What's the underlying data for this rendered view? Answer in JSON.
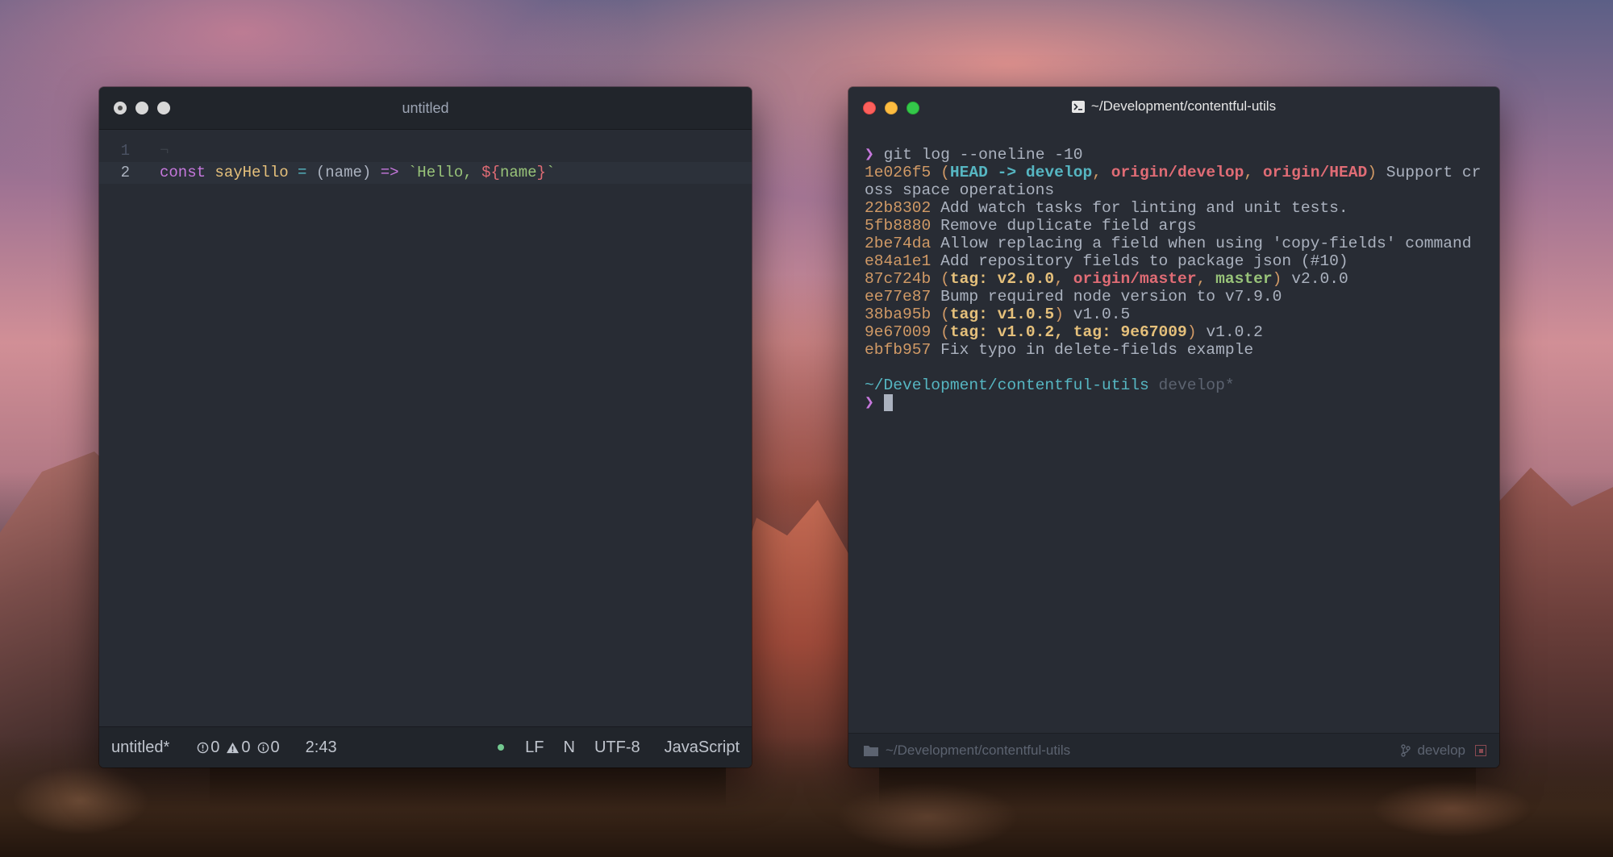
{
  "colors": {
    "text": "#abb2bf",
    "hash": "#d19a66",
    "cyan": "#56b6c2",
    "green": "#98c379",
    "red": "#e06c75",
    "yellow": "#e5c07b",
    "purple": "#c678dd",
    "muted": "#5c6370"
  },
  "editor": {
    "title": "untitled",
    "lines": [
      {
        "number": "1",
        "content": "¬"
      },
      {
        "number": "2",
        "tokens": {
          "kw": "const",
          "fn": "sayHello",
          "op": "=",
          "lp": "(",
          "param": "name",
          "rp": ")",
          "arrow": "=>",
          "str": "`Hello, ",
          "interp_open": "${",
          "interp_var": "name",
          "interp_close": "}",
          "str_end": "`"
        }
      }
    ],
    "status": {
      "file": "untitled*",
      "errors": "0",
      "warnings": "0",
      "infos": "0",
      "cursor_pos": "2:43",
      "line_ending": "LF",
      "indent": "N",
      "encoding": "UTF-8",
      "grammar": "JavaScript"
    }
  },
  "terminal": {
    "title": "~/Development/contentful-utils",
    "prompt_symbol": "❯",
    "command": "git log --oneline -10",
    "log": [
      {
        "hash": "1e026f5",
        "refs": [
          "HEAD -> develop",
          "origin/develop",
          "origin/HEAD"
        ],
        "message": "Support cr",
        "wrap": "oss space operations"
      },
      {
        "hash": "22b8302",
        "message": "Add watch tasks for linting and unit tests."
      },
      {
        "hash": "5fb8880",
        "message": "Remove duplicate field args"
      },
      {
        "hash": "2be74da",
        "message": "Allow replacing a field when using 'copy-fields' command"
      },
      {
        "hash": "e84a1e1",
        "message": "Add repository fields to package json (#10)"
      },
      {
        "hash": "87c724b",
        "refs": [
          "tag: v2.0.0",
          "origin/master",
          "master"
        ],
        "message": "v2.0.0"
      },
      {
        "hash": "ee77e87",
        "message": "Bump required node version to v7.9.0"
      },
      {
        "hash": "38ba95b",
        "refs": [
          "tag: v1.0.5"
        ],
        "message": "v1.0.5"
      },
      {
        "hash": "9e67009",
        "refs": [
          "tag: v1.0.2, tag: 9e67009"
        ],
        "message": "v1.0.2"
      },
      {
        "hash": "ebfb957",
        "message": "Fix typo in delete-fields example"
      }
    ],
    "cwd": "~/Development/contentful-utils",
    "branch": "develop*",
    "footer": {
      "path": "~/Development/contentful-utils",
      "branch": "develop"
    }
  }
}
